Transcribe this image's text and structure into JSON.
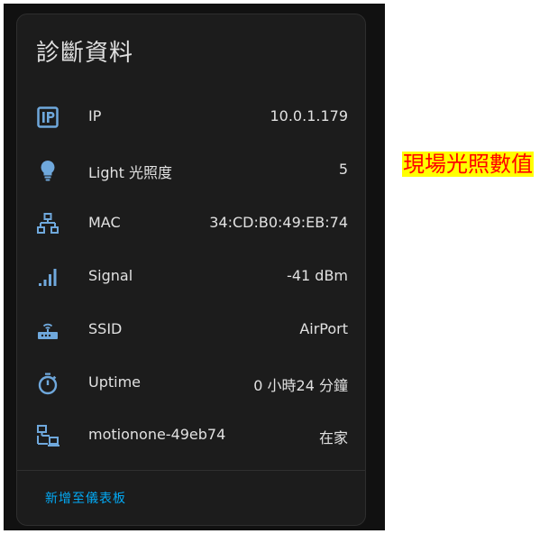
{
  "card": {
    "title": "診斷資料",
    "rows": [
      {
        "icon": "ip-icon",
        "label": "IP",
        "value": "10.0.1.179"
      },
      {
        "icon": "lightbulb-icon",
        "label": "Light 光照度",
        "value": "5"
      },
      {
        "icon": "network-icon",
        "label": "MAC",
        "value": "34:CD:B0:49:EB:74"
      },
      {
        "icon": "signal-icon",
        "label": "Signal",
        "value": "-41 dBm"
      },
      {
        "icon": "router-wifi-icon",
        "label": "SSID",
        "value": "AirPort"
      },
      {
        "icon": "timer-icon",
        "label": "Uptime",
        "value": "0 小時24 分鐘"
      },
      {
        "icon": "lan-icon",
        "label": "motionone-49eb74",
        "value": "在家"
      }
    ],
    "footer_link": "新增至儀表板"
  },
  "annotation": {
    "text": "現場光照數值",
    "background": "#ffff00",
    "color": "#ff0000"
  },
  "colors": {
    "icon": "#6fa8dc",
    "accent": "#03a9f4",
    "text": "#e1e1e1",
    "card_bg": "#1c1c1c"
  }
}
